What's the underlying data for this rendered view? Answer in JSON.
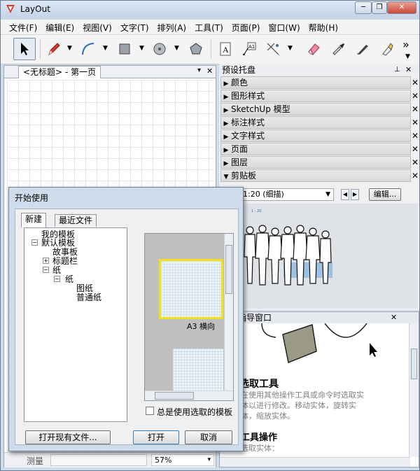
{
  "window": {
    "title": "LayOut",
    "min": "─",
    "restore": "❐",
    "close": "✕"
  },
  "menu": [
    "文件(F)",
    "编辑(E)",
    "视图(V)",
    "文字(T)",
    "排列(A)",
    "工具(T)",
    "页面(P)",
    "窗口(W)",
    "帮助(H)"
  ],
  "toolbar": {
    "more": "»"
  },
  "document": {
    "tab_label": "<无标题> - 第一页",
    "pin": "▾",
    "close": "✕"
  },
  "statusbar": {
    "measure_label": "测量",
    "zoom": "57%",
    "dropdown": "▾"
  },
  "tray": {
    "title": "预设托盘",
    "pin": "⊥",
    "close": "✕",
    "panels": [
      {
        "label": "颜色"
      },
      {
        "label": "图形样式"
      },
      {
        "label": "SketchUp 模型"
      },
      {
        "label": "标注样式"
      },
      {
        "label": "文字样式"
      },
      {
        "label": "页面"
      },
      {
        "label": "图层"
      },
      {
        "label": "剪贴板"
      }
    ],
    "clipboard": {
      "scale": "1:20 (细描)",
      "edit_button": "编辑...",
      "tiny_label": "1 : 20"
    }
  },
  "instructor": {
    "title": "指导窗口",
    "heading": "选取工具",
    "lines": [
      "在使用其他操作工具或命令时选取实",
      "体以进行修改。移动实体，旋转实",
      "体，缩放实体。"
    ],
    "subheading": "工具操作",
    "sub_line": "选取实体："
  },
  "dialog": {
    "title": "开始使用",
    "tabs": [
      "新建",
      "最近文件"
    ],
    "tree": [
      "我的模板",
      "默认模板",
      "故事板",
      "标题栏",
      "纸",
      "纸",
      "图纸",
      "普通纸"
    ],
    "template_caption": "A3 横向",
    "checkbox_label": "总是使用选取的模板",
    "open_existing": "打开现有文件...",
    "open": "打开",
    "cancel": "取消"
  },
  "colors": {
    "accent": "#3c7fb1",
    "selected_template_border": "#f2e21a",
    "close_red": "#c9483a"
  }
}
